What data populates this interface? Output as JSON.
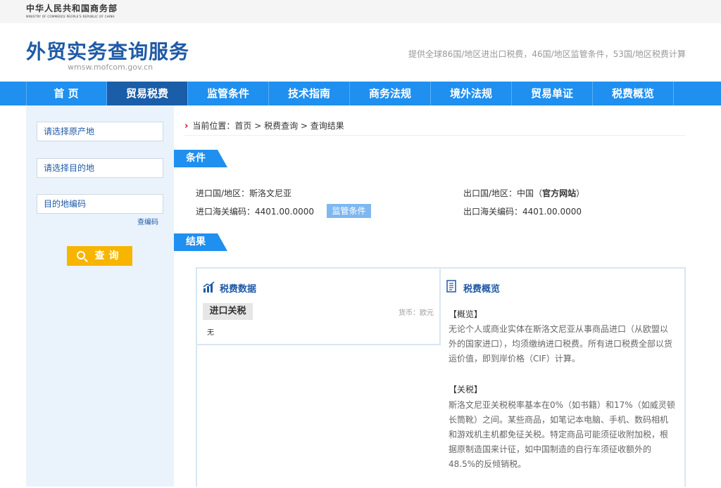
{
  "top": {
    "ministry_cn": "中华人民共和国商务部",
    "ministry_en": "MINISTRY OF COMMERCE PEOPLE'S REPUBLIC OF CHINA"
  },
  "header": {
    "title": "外贸实务查询服务",
    "domain": "wmsw.mofcom.gov.cn",
    "slogan": "提供全球86国/地区进出口税费，46国/地区监管条件，53国/地区税费计算"
  },
  "nav": {
    "items": [
      "首 页",
      "贸易税费",
      "监管条件",
      "技术指南",
      "商务法规",
      "境外法规",
      "贸易单证",
      "税费概览"
    ],
    "active_index": 1
  },
  "sidebar": {
    "origin_placeholder": "请选择原产地",
    "destination_placeholder": "请选择目的地",
    "code_placeholder": "目的地编码",
    "lookup_code_link": "查编码",
    "query_button": "查询"
  },
  "breadcrumb": {
    "label": "当前位置：",
    "home": "首页",
    "level2": "税费查询",
    "level3": "查询结果",
    "sep": " > "
  },
  "conditions": {
    "section_title": "条件",
    "import_country_label": "进口国/地区：",
    "import_country": "斯洛文尼亚",
    "import_hs_label": "进口海关编码：",
    "import_hs": "4401.00.0000",
    "regulation_button": "监管条件",
    "export_country_label": "出口国/地区：",
    "export_country": "中国",
    "official_site": "官方网站",
    "export_hs_label": "出口海关编码：",
    "export_hs": "4401.00.0000"
  },
  "results": {
    "section_title": "结果",
    "tax_data_title": "税费数据",
    "import_duty_tab": "进口关税",
    "currency": "货币：欧元",
    "import_duty_value": "无",
    "overview_title": "税费概览",
    "overview_heading": "【概览】",
    "overview_text": "无论个人或商业实体在斯洛文尼亚从事商品进口（从欧盟以外的国家进口），均须缴纳进口税费。所有进口税费全部以货运价值，即到岸价格（CIF）计算。",
    "tariff_heading": "【关税】",
    "tariff_text": "斯洛文尼亚关税税率基本在0%（如书籍）和17%（如威灵顿长筒靴）之间。某些商品，如笔记本电脑、手机、数码相机和游戏机主机都免征关税。特定商品可能须征收附加税，根据原制造国来计征，如中国制造的自行车须征收额外的48.5%的反倾销税。"
  },
  "colors": {
    "nav_blue": "#1f8ff0",
    "nav_active": "#1a5da8",
    "title_blue": "#1f5aa6",
    "button_yellow": "#f7b500",
    "sidebar_bg": "#eaf3fc"
  }
}
